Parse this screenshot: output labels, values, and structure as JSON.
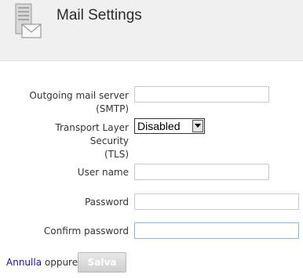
{
  "header": {
    "title": "Mail Settings",
    "icon": "mail-server-icon"
  },
  "form": {
    "smtp": {
      "label_line1": "Outgoing mail server",
      "label_line2": "(SMTP)",
      "value": ""
    },
    "tls": {
      "label_line1": "Transport Layer",
      "label_line2": "Security",
      "label_line3": "(TLS)",
      "selected": "Disabled"
    },
    "username": {
      "label": "User name",
      "value": ""
    },
    "password": {
      "label": "Password",
      "value": ""
    },
    "confirm_password": {
      "label": "Confirm password",
      "value": ""
    }
  },
  "actions": {
    "cancel_label": "Annulla",
    "or_text": "oppure",
    "save_label": "Salva"
  },
  "colors": {
    "header_bg": "#f0f0f0",
    "link": "#1a0dab",
    "focus_border": "#8fb8d8"
  }
}
